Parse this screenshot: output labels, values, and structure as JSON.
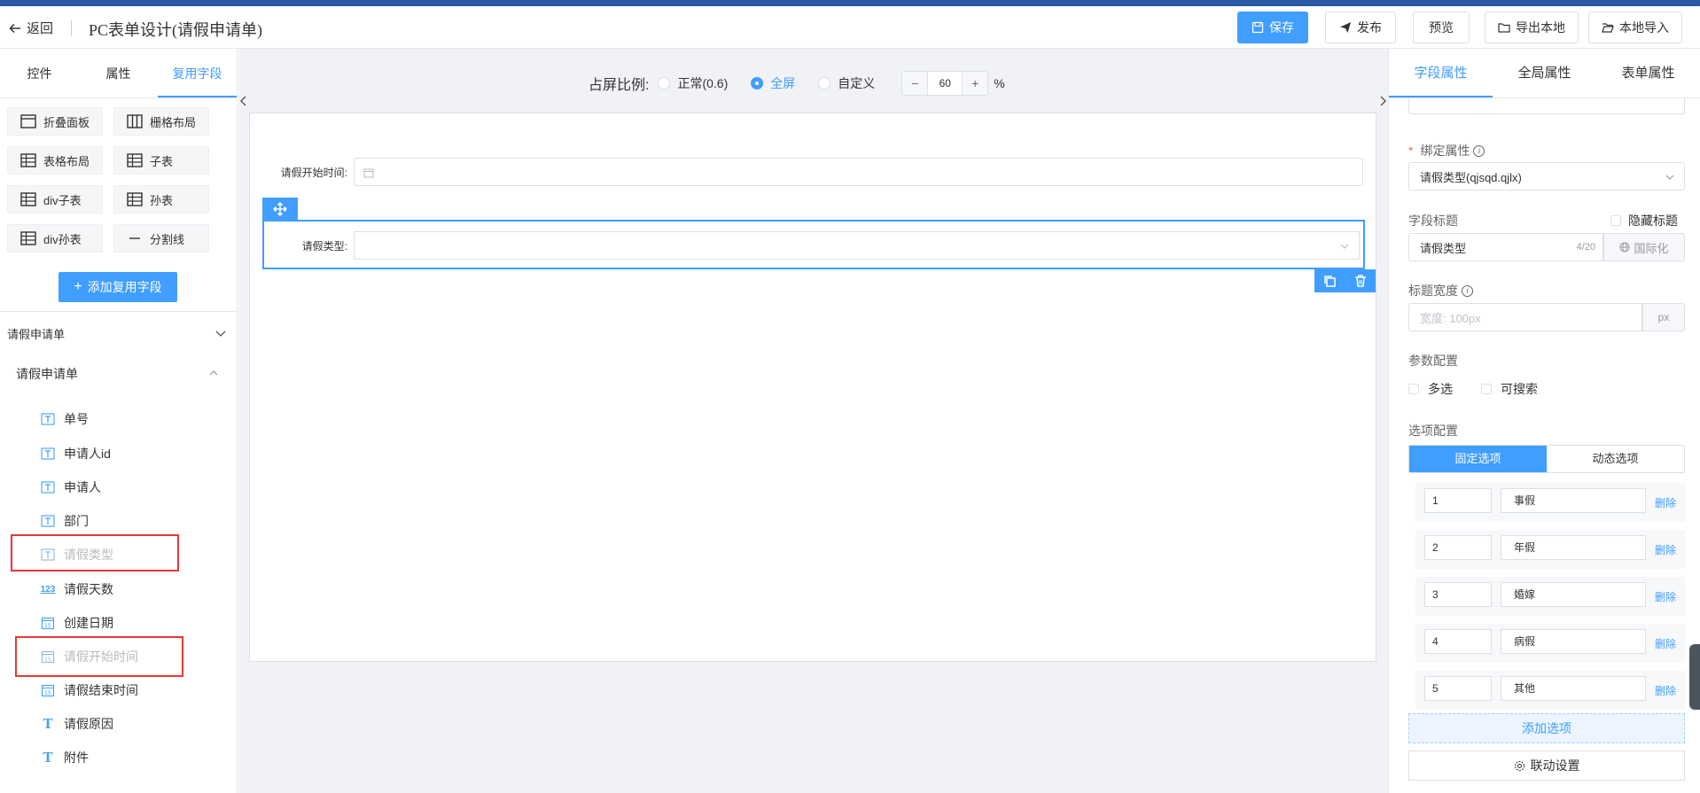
{
  "header": {
    "back_label": "返回",
    "title": "PC表单设计(请假申请单)",
    "buttons": {
      "save": "保存",
      "publish": "发布",
      "preview": "预览",
      "export": "导出本地",
      "import": "本地导入"
    }
  },
  "left": {
    "tabs": [
      "控件",
      "属性",
      "复用字段"
    ],
    "active_tab": "复用字段",
    "widgets": [
      "折叠面板",
      "栅格布局",
      "表格布局",
      "子表",
      "div子表",
      "孙表",
      "div孙表",
      "分割线"
    ],
    "add_reuse_label": "添加复用字段",
    "group_title": "请假申请单",
    "subgroup_title": "请假申请单",
    "fields": [
      {
        "label": "单号",
        "icon": "text-field-icon",
        "dim": false
      },
      {
        "label": "申请人id",
        "icon": "text-field-icon",
        "dim": false
      },
      {
        "label": "申请人",
        "icon": "text-field-icon",
        "dim": false
      },
      {
        "label": "部门",
        "icon": "text-field-icon",
        "dim": false
      },
      {
        "label": "请假类型",
        "icon": "text-field-icon",
        "dim": true
      },
      {
        "label": "请假天数",
        "icon": "number-field-icon",
        "dim": false
      },
      {
        "label": "创建日期",
        "icon": "date-field-icon",
        "dim": false
      },
      {
        "label": "请假开始时间",
        "icon": "date-field-icon",
        "dim": true
      },
      {
        "label": "请假结束时间",
        "icon": "date-field-icon",
        "dim": false
      },
      {
        "label": "请假原因",
        "icon": "textarea-field-icon",
        "dim": false
      },
      {
        "label": "附件",
        "icon": "textarea-field-icon",
        "dim": false
      }
    ]
  },
  "canvas": {
    "ratio_label": "占屏比例:",
    "ratio_options": [
      "正常(0.6)",
      "全屏",
      "自定义"
    ],
    "ratio_selected": "全屏",
    "stepper_minus": "−",
    "stepper_value": "60",
    "stepper_plus": "+",
    "percent_sign": "%",
    "form_fields": [
      {
        "label": "请假开始时间:",
        "type": "date"
      },
      {
        "label": "请假类型:",
        "type": "select"
      }
    ]
  },
  "right": {
    "tabs": [
      "字段属性",
      "全局属性",
      "表单属性"
    ],
    "active_tab": "字段属性",
    "bind_label": "绑定属性",
    "bind_value": "请假类型(qjsqd.qjlx)",
    "field_title_label": "字段标题",
    "hide_title_label": "隐藏标题",
    "field_title_value": "请假类型",
    "field_title_count": "4/20",
    "i18n_label": "国际化",
    "title_width_label": "标题宽度",
    "title_width_placeholder": "宽度: 100px",
    "title_width_unit": "px",
    "param_label": "参数配置",
    "param_multi": "多选",
    "param_search": "可搜索",
    "options_label": "选项配置",
    "options_tabs": [
      "固定选项",
      "动态选项"
    ],
    "options_active": "固定选项",
    "delete_label": "删除",
    "options": [
      {
        "value": "1",
        "label": "事假"
      },
      {
        "value": "2",
        "label": "年假"
      },
      {
        "value": "3",
        "label": "婚嫁"
      },
      {
        "value": "4",
        "label": "病假"
      },
      {
        "value": "5",
        "label": "其他"
      }
    ],
    "add_option_label": "添加选项",
    "linkage_label": "联动设置"
  },
  "colors": {
    "accent": "#409eff",
    "top_strip": "#2c5aa8",
    "highlight_box": "#e53935"
  }
}
